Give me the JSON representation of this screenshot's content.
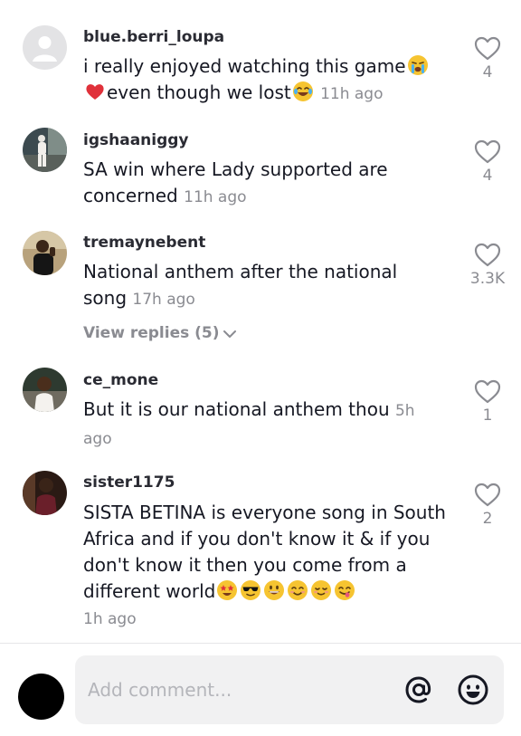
{
  "comments": [
    {
      "username": "blue.berri_loupa",
      "text_1": "i really enjoyed watching this game",
      "text_2": "even though we lost",
      "time": "11h ago",
      "likes": "4"
    },
    {
      "username": "igshaaniggy",
      "text": "SA win where Lady supported are concerned",
      "time": "11h ago",
      "likes": "4"
    },
    {
      "username": "tremaynebent",
      "text": "National anthem after the national song",
      "time": "17h ago",
      "likes": "3.3K",
      "view_replies": "View replies (5)"
    },
    {
      "username": "ce_mone",
      "text": "But it is our national anthem thou",
      "time": "5h ago",
      "likes": "1"
    },
    {
      "username": "sister1175",
      "text": "SISTA BETINA is everyone song in South Africa and if you don't know it & if you don't know it then you come from a different world",
      "time": "1h ago",
      "likes": "2"
    }
  ],
  "composer": {
    "placeholder": "Add comment..."
  },
  "icons": {
    "like": "heart-outline-icon",
    "mention": "at-sign-icon",
    "emoji": "smiley-icon",
    "expand": "chevron-down-icon"
  },
  "colors": {
    "text": "#161823",
    "secondary_text": "#8a8b91",
    "input_background": "#f1f1f2"
  }
}
